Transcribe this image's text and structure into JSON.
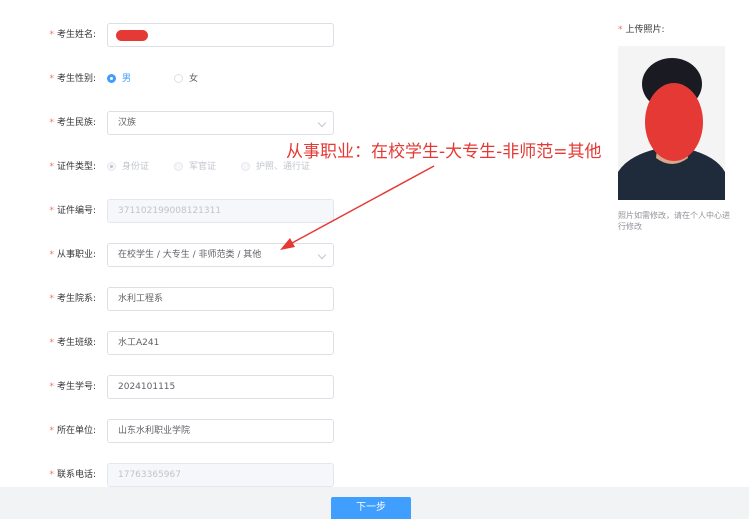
{
  "form": {
    "name": {
      "label": "考生姓名:",
      "value": ""
    },
    "gender": {
      "label": "考生性别:",
      "options": [
        "男",
        "女"
      ],
      "selected": "男"
    },
    "ethnicity": {
      "label": "考生民族:",
      "value": "汉族"
    },
    "id_type": {
      "label": "证件类型:",
      "options": [
        "身份证",
        "军官证",
        "护照、通行证"
      ],
      "selected": "身份证"
    },
    "id_number": {
      "label": "证件编号:",
      "value": "371102199008121311"
    },
    "occupation": {
      "label": "从事职业:",
      "value": "在校学生 / 大专生 / 非师范类 / 其他"
    },
    "department": {
      "label": "考生院系:",
      "value": "水利工程系"
    },
    "class": {
      "label": "考生班级:",
      "value": "水工A241"
    },
    "student_id": {
      "label": "考生学号:",
      "value": "2024101115"
    },
    "organization": {
      "label": "所在单位:",
      "value": "山东水利职业学院"
    },
    "phone": {
      "label": "联系电话:",
      "value": "17763365967"
    }
  },
  "annotation": "从事职业：在校学生-大专生-非师范=其他",
  "photo": {
    "label": "上传照片:",
    "note": "照片如需修改，请在个人中心进行修改"
  },
  "footer": {
    "next_label": "下一步"
  }
}
